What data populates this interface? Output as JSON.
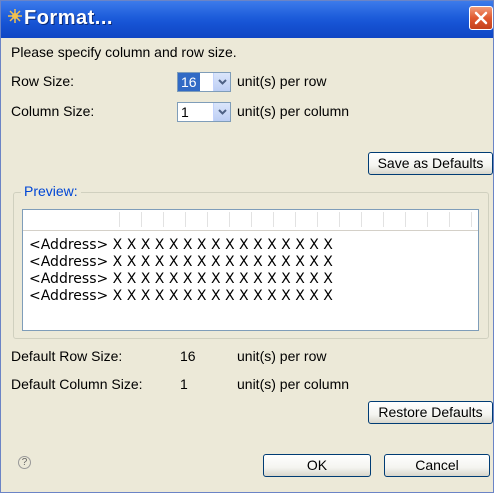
{
  "window": {
    "title": "Format..."
  },
  "instructions": "Please specify column and row size.",
  "row_size": {
    "label": "Row Size:",
    "value": "16",
    "unit": "unit(s) per row"
  },
  "column_size": {
    "label": "Column Size:",
    "value": "1",
    "unit": "unit(s) per column"
  },
  "buttons": {
    "save_defaults": "Save as Defaults",
    "restore_defaults": "Restore Defaults",
    "ok": "OK",
    "cancel": "Cancel"
  },
  "preview": {
    "label": "Preview:",
    "rows": [
      "<Address> X X X X X X X X X X X X X X X X",
      "<Address> X X X X X X X X X X X X X X X X",
      "<Address> X X X X X X X X X X X X X X X X",
      "<Address> X X X X X X X X X X X X X X X X"
    ]
  },
  "defaults": {
    "row_label": "Default Row Size:",
    "row_value": "16",
    "row_unit": "unit(s) per row",
    "column_label": "Default Column Size:",
    "column_value": "1",
    "column_unit": "unit(s) per column"
  },
  "icons": {
    "title": "app-icon",
    "close": "close-icon",
    "help": "help-icon",
    "dropdown": "chevron-down-icon"
  },
  "colors": {
    "titlebar": "#1f5fdc",
    "close": "#e0582e",
    "accent": "#0046d5",
    "selection": "#316ac5",
    "dialog_bg": "#ece9d8"
  }
}
